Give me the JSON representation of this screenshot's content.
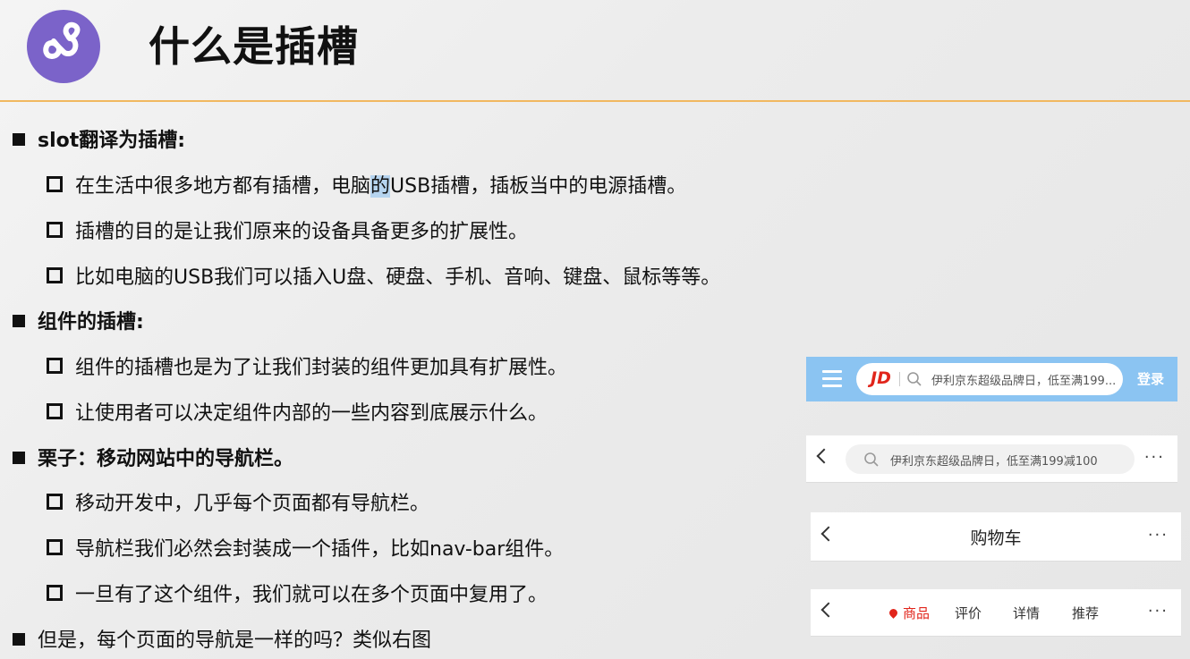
{
  "title": "什么是插槽",
  "sections": [
    {
      "heading": "slot翻译为插槽:",
      "items": [
        {
          "before": "在生活中很多地方都有插槽，电脑",
          "highlight": "的",
          "after": "USB插槽，插板当中的电源插槽。"
        },
        {
          "text": "插槽的目的是让我们原来的设备具备更多的扩展性。"
        },
        {
          "text": "比如电脑的USB我们可以插入U盘、硬盘、手机、音响、键盘、鼠标等等。"
        }
      ]
    },
    {
      "heading": "组件的插槽:",
      "items": [
        {
          "text": "组件的插槽也是为了让我们封装的组件更加具有扩展性。"
        },
        {
          "text": "让使用者可以决定组件内部的一些内容到底展示什么。"
        }
      ]
    },
    {
      "heading": "栗子：移动网站中的导航栏。",
      "items": [
        {
          "text": "移动开发中，几乎每个页面都有导航栏。"
        },
        {
          "text": "导航栏我们必然会封装成一个插件，比如nav-bar组件。"
        },
        {
          "text": "一旦有了这个组件，我们就可以在多个页面中复用了。"
        }
      ]
    },
    {
      "heading": "但是，每个页面的导航是一样的吗？类似右图",
      "items": []
    }
  ],
  "navbars": {
    "jd": {
      "logo": "JD",
      "placeholder": "伊利京东超级品牌日，低至满199...",
      "login": "登录"
    },
    "search": {
      "placeholder": "伊利京东超级品牌日，低至满199减100",
      "more": "···"
    },
    "cart": {
      "title": "购物车",
      "more": "···"
    },
    "product": {
      "tabs": [
        "商品",
        "评价",
        "详情",
        "推荐"
      ],
      "more": "···"
    }
  },
  "colors": {
    "accent_rule": "#f1b860",
    "logo": "#7b63c9",
    "jd_red": "#e1251b",
    "jd_bar": "#8bc4f2"
  }
}
